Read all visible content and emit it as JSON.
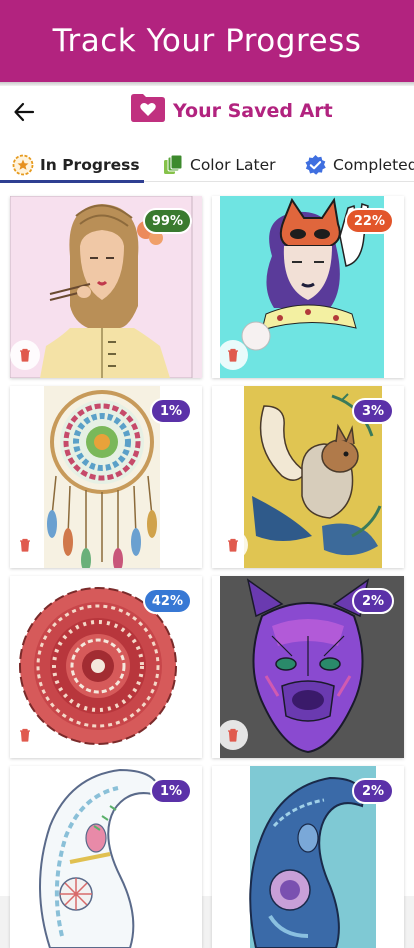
{
  "banner": {
    "title": "Track Your Progress"
  },
  "header": {
    "title": "Your Saved Art",
    "back_icon": "arrow-left-icon",
    "folder_icon": "heart-folder-icon"
  },
  "colors": {
    "brand": "#b2237f",
    "tab_underline": "#2f3f92",
    "badge_green": "#3a7a2f",
    "badge_orange": "#e2552a",
    "badge_purple": "#5a31a8",
    "badge_blue": "#3778d4",
    "trash_red": "#e05a4e"
  },
  "tabs": [
    {
      "label": "In Progress",
      "icon": "star-circle-icon",
      "active": true
    },
    {
      "label": "Color Later",
      "icon": "stacked-cards-icon",
      "active": false
    },
    {
      "label": "Completed",
      "icon": "check-badge-icon",
      "active": false
    }
  ],
  "artworks": [
    {
      "progress": "99%",
      "subject": "geisha-woman",
      "badge_color": "green"
    },
    {
      "progress": "22%",
      "subject": "cat-mask-woman",
      "badge_color": "orange"
    },
    {
      "progress": "1%",
      "subject": "dreamcatcher",
      "badge_color": "purple"
    },
    {
      "progress": "3%",
      "subject": "squirrel",
      "badge_color": "purple"
    },
    {
      "progress": "42%",
      "subject": "mandala",
      "badge_color": "blue"
    },
    {
      "progress": "2%",
      "subject": "dog-head",
      "badge_color": "purple"
    },
    {
      "progress": "1%",
      "subject": "paisley-outline",
      "badge_color": "purple"
    },
    {
      "progress": "2%",
      "subject": "paisley-teal",
      "badge_color": "purple"
    }
  ]
}
